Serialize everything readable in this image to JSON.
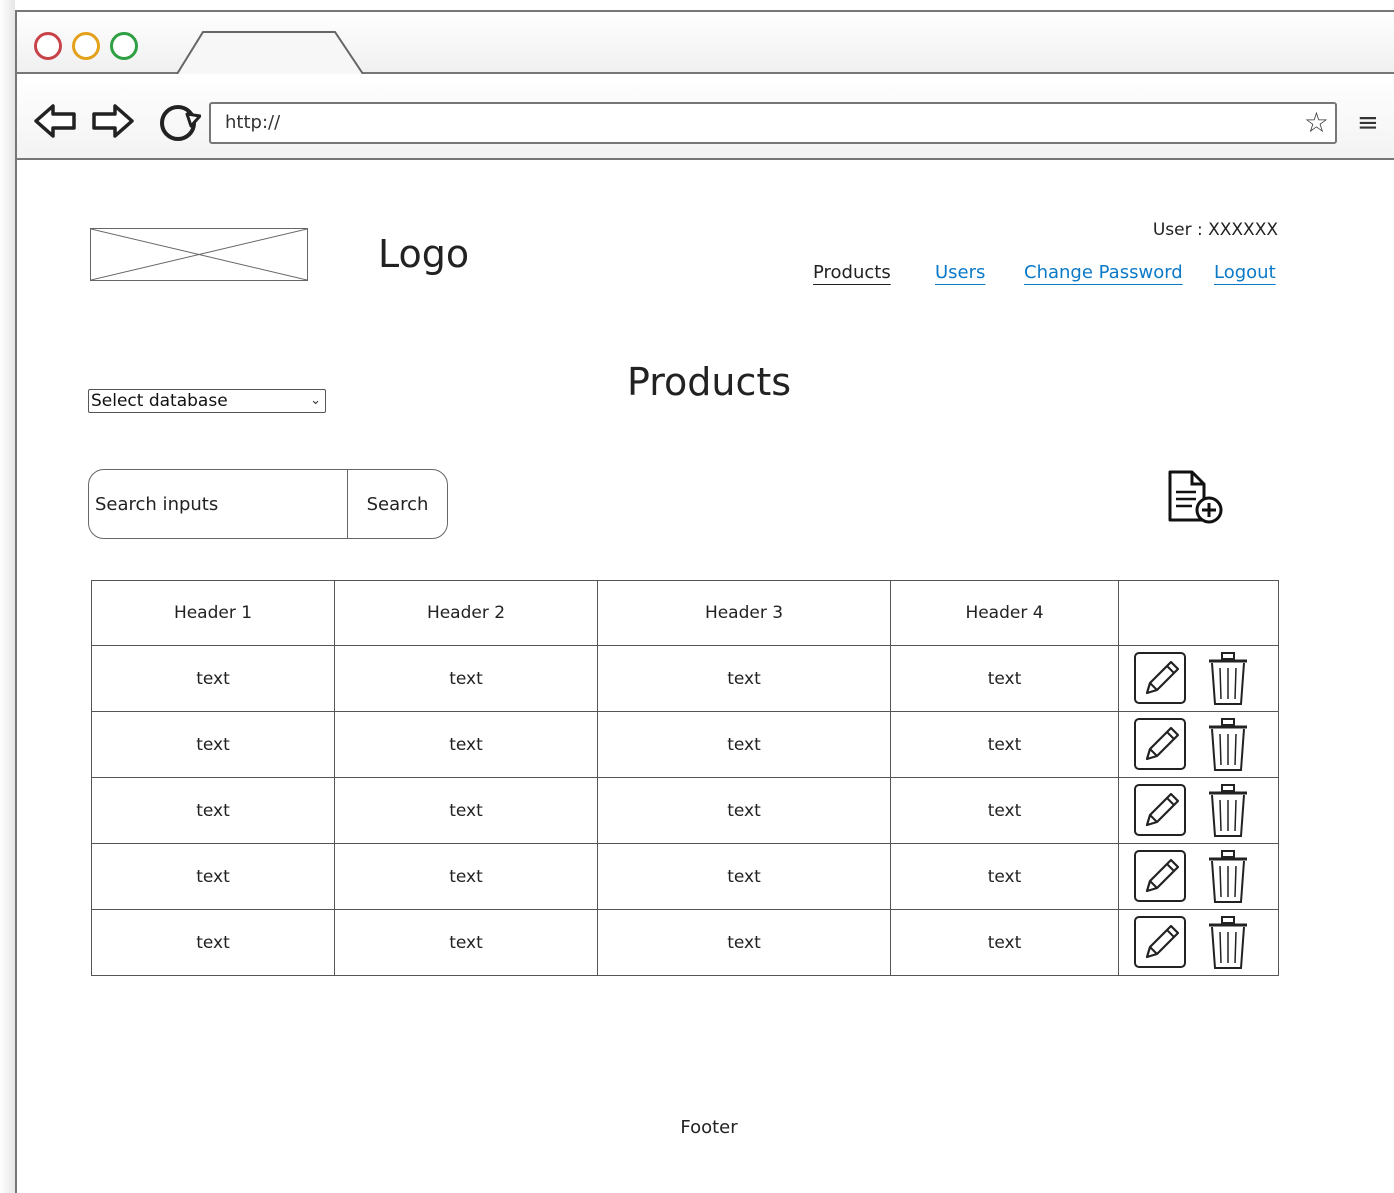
{
  "browser": {
    "url": "http://"
  },
  "header": {
    "logo_text": "Logo",
    "user_label": "User : XXXXXX",
    "nav": [
      {
        "label": "Products",
        "state": "active"
      },
      {
        "label": "Users",
        "state": "link"
      },
      {
        "label": "Change Password",
        "state": "link"
      },
      {
        "label": "Logout",
        "state": "link"
      }
    ]
  },
  "main": {
    "title": "Products",
    "database_select": {
      "selected": "Select database"
    },
    "search": {
      "placeholder": "Search inputs",
      "button_label": "Search"
    },
    "table": {
      "headers": [
        "Header 1",
        "Header 2",
        "Header 3",
        "Header 4",
        ""
      ],
      "rows": [
        [
          "text",
          "text",
          "text",
          "text"
        ],
        [
          "text",
          "text",
          "text",
          "text"
        ],
        [
          "text",
          "text",
          "text",
          "text"
        ],
        [
          "text",
          "text",
          "text",
          "text"
        ],
        [
          "text",
          "text",
          "text",
          "text"
        ]
      ]
    }
  },
  "footer": {
    "text": "Footer"
  },
  "colors": {
    "link": "#0b79c8",
    "text": "#222222",
    "border": "#555555"
  },
  "icons": [
    "back-arrow-icon",
    "forward-arrow-icon",
    "reload-icon",
    "star-icon",
    "menu-icon",
    "add-document-icon",
    "edit-icon",
    "trash-icon"
  ]
}
